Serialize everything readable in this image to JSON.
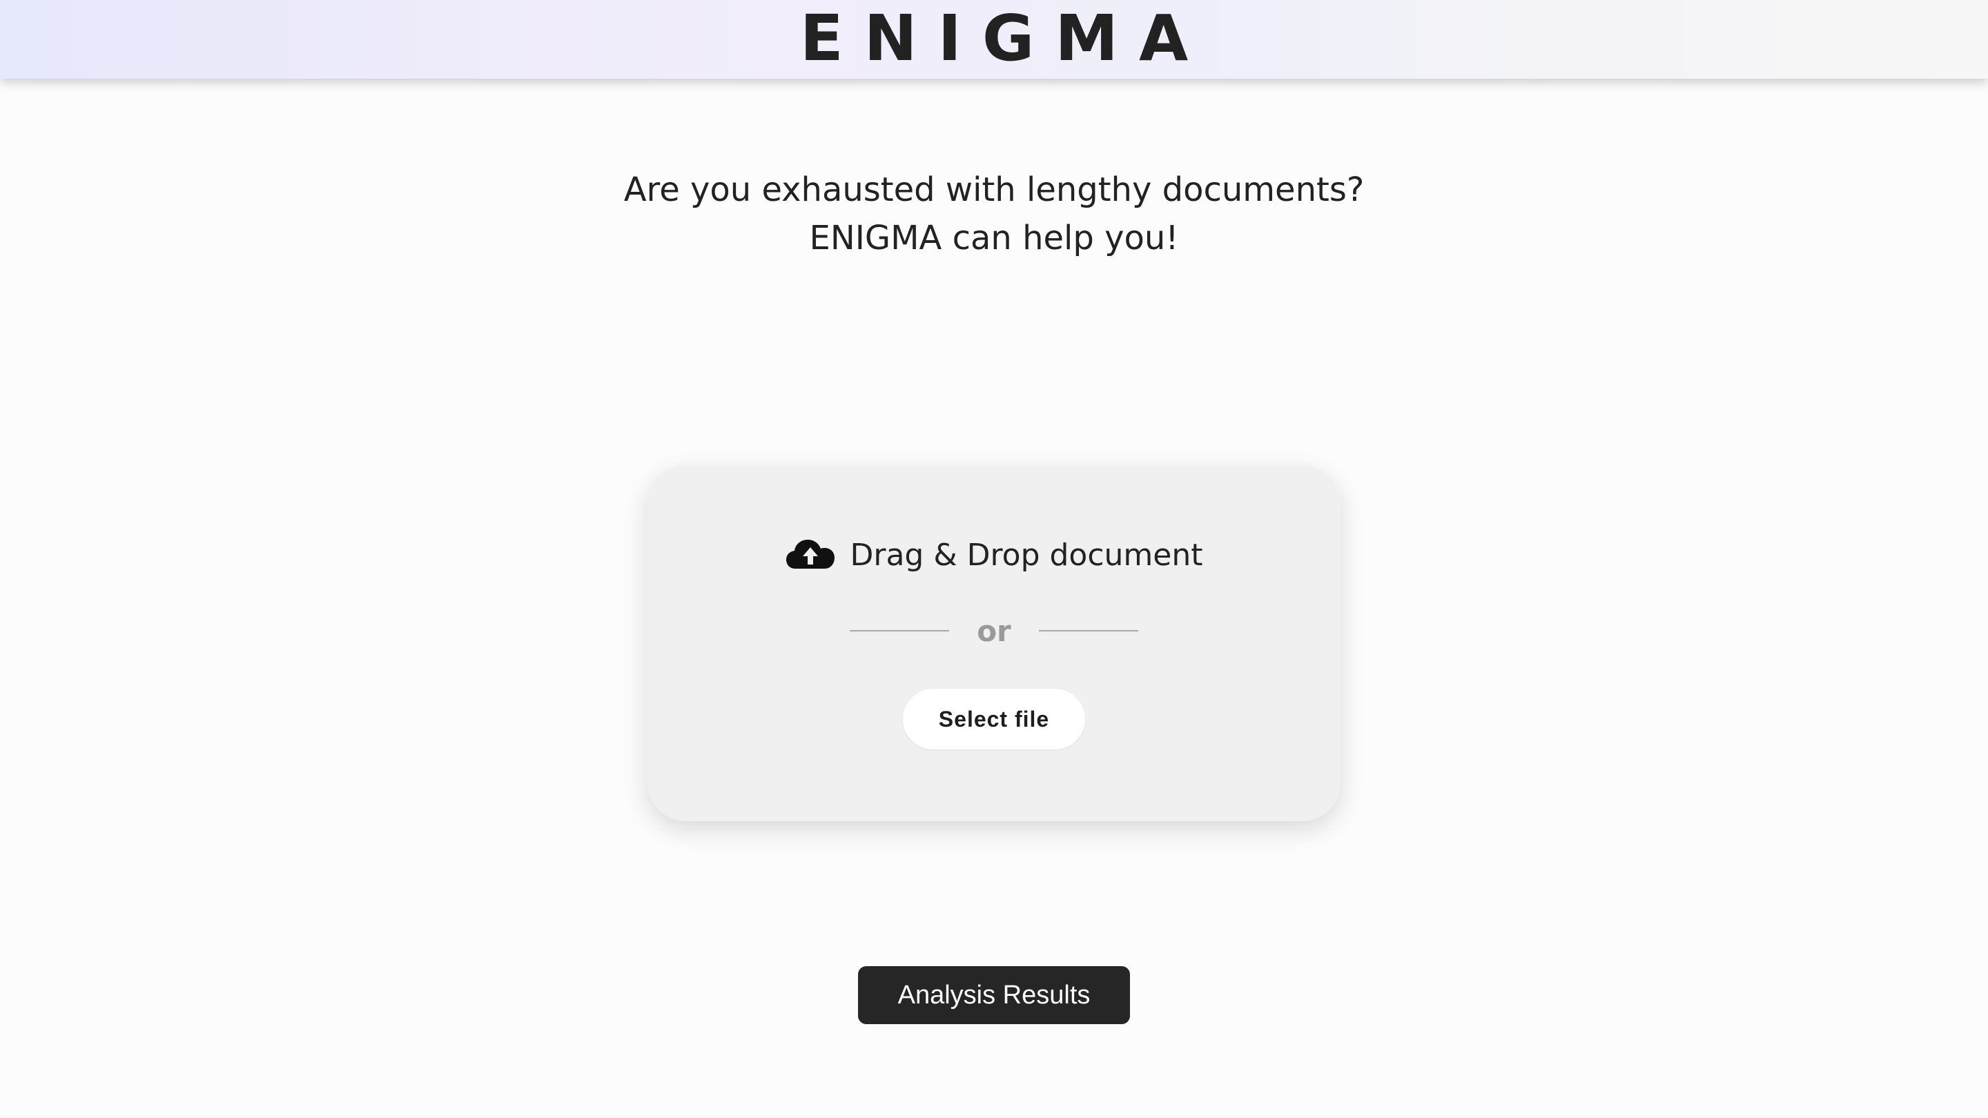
{
  "header": {
    "logo_text": "ENIGMA"
  },
  "headline": {
    "line1": "Are you exhausted with lengthy documents?",
    "line2": "ENIGMA can help you!"
  },
  "upload": {
    "drag_drop_label": "Drag & Drop document",
    "or_label": "or",
    "select_file_label": "Select file",
    "icon": "cloud-upload-icon"
  },
  "actions": {
    "analysis_results_label": "Analysis Results"
  },
  "colors": {
    "primary_button": "#262626",
    "card_background": "#f1f0f0",
    "page_background": "#fcfcfc"
  }
}
